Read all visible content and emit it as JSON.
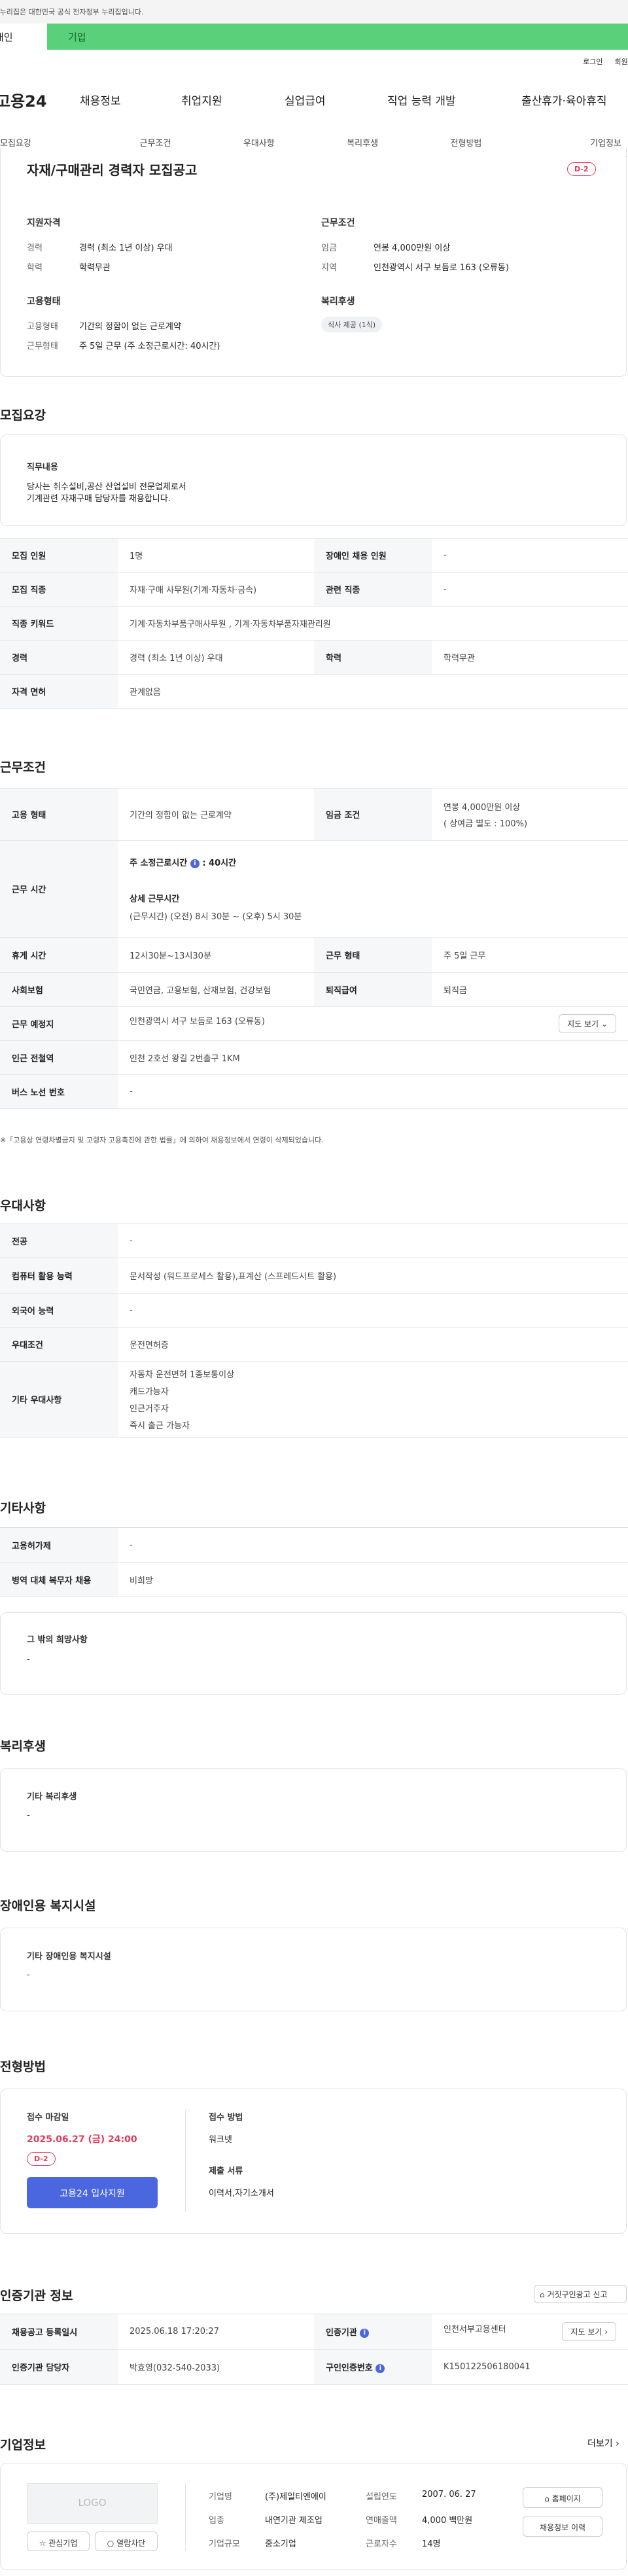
{
  "notice": "이 누리집은 대한민국 공식 전자정부 누리집입니다.",
  "context_tabs": {
    "left": "개인",
    "right": "기업"
  },
  "util": {
    "login": "로그인",
    "join": "회원가입"
  },
  "gnb": {
    "logo": "고용24",
    "menu": [
      "채용정보",
      "취업지원",
      "실업급여",
      "직업 능력 개발",
      "출산휴가·육아휴직"
    ]
  },
  "subtabs": [
    "모집요강",
    "근무조건",
    "우대사항",
    "복리후생",
    "전형방법",
    "기업정보"
  ],
  "summary": {
    "title": "자재/구매관리 경력자 모집공고",
    "dday": "D-2",
    "support": {
      "heading": "지원자격",
      "career_k": "경력",
      "career_v": "경력 (최소 1년 이상) 우대",
      "edu_k": "학력",
      "edu_v": "학력무관"
    },
    "condition": {
      "heading": "근무조건",
      "wage_k": "임금",
      "wage_v": "연봉 4,000만원 이상",
      "region_k": "지역",
      "region_v": "인천광역시 서구 보듬로 163 (오류동)"
    },
    "employment": {
      "heading": "고용형태",
      "type_k": "고용형태",
      "type_v": "기간의 정함이 없는 근로계약",
      "hours_k": "근무형태",
      "hours_v": "주 5일 근무 (주 소정근로시간: 40시간)"
    },
    "welfare": {
      "heading": "복리후생",
      "chip": "식사 제공 (1식)"
    }
  },
  "recruit": {
    "heading": "모집요강",
    "job_title": "직무내용",
    "job_desc1": "당사는 취수설비,공산 산업설비 전문업체로서",
    "job_desc2": "기계관련 자재구매 담당자를 채용합니다.",
    "rows": {
      "r1_k": "모집 인원",
      "r1_v": "1명",
      "r1_k2": "장애인 채용 인원",
      "r1_v2": "-",
      "r2_k": "모집 직종",
      "r2_v": "자재·구매 사무원(기계·자동차·금속)",
      "r2_k2": "관련 직종",
      "r2_v2": "-",
      "r3_k": "직종 키워드",
      "r3_v": "기계·자동차부품구매사무원 , 기계·자동차부품자재관리원",
      "r4_k": "경력",
      "r4_v": "경력 (최소 1년 이상) 우대",
      "r4_k2": "학력",
      "r4_v2": "학력무관",
      "r5_k": "자격 면허",
      "r5_v": "관계없음"
    }
  },
  "work": {
    "heading": "근무조건",
    "type_k": "고용 형태",
    "type_v": "기간의 정함이 없는 근로계약",
    "wage_k": "임금 조건",
    "wage_v1": "연봉 4,000만원 이상",
    "wage_v2": "( 상여금 별도 : 100%)",
    "hours_k": "근무 시간",
    "hours_v1": "주 소정근로시간",
    "hours_v1b": ": 40시간",
    "hours_v2": "상세 근무시간",
    "hours_v3": "(근무시간) (오전) 8시 30분 ~ (오후) 5시 30분",
    "rest_k": "휴게 시간",
    "rest_v": "12시30분~13시30분",
    "form_k": "근무 형태",
    "form_v": "주 5일 근무",
    "ins_k": "사회보험",
    "ins_v": "국민연금, 고용보험, 산재보험, 건강보험",
    "ret_k": "퇴직급여",
    "ret_v": "퇴직금",
    "place_k": "근무 예정지",
    "place_v": "인천광역시 서구 보듬로 163 (오류동)",
    "map_btn": "지도 보기",
    "sub_k": "인근 전철역",
    "sub_v": "인천 2호선 왕길 2번출구 1KM",
    "bus_k": "버스 노선 번호",
    "bus_v": "-",
    "note": "※「고용상 연령차별금지 및 고령자 고용촉진에 관한 법률」에 의하여 채용정보에서 연령이 삭제되었습니다."
  },
  "pref": {
    "heading": "우대사항",
    "major_k": "전공",
    "major_v": "-",
    "pc_k": "컴퓨터 활용 능력",
    "pc_v": "문서작성 (워드프로세스 활용),표계산 (스프레드시트 활용)",
    "lang_k": "외국어 능력",
    "lang_v": "-",
    "cond_k": "우대조건",
    "cond_v": "운전면허증",
    "etc_k": "기타 우대사항",
    "etc_v": [
      "자동차 운전면허 1종보통이상",
      "캐드가능자",
      "인근거주자",
      "즉시 출근 가능자"
    ]
  },
  "other": {
    "heading": "기타사항",
    "ins_k": "고용허가제",
    "ins_v": "-",
    "mil_k": "병역 대체 복무자 채용",
    "mil_v": "비희망",
    "hope_title": "그 밖의 희망사항",
    "hope_v": "-"
  },
  "welfare": {
    "heading": "복리후생",
    "title": "기타 복리후생",
    "v": "-"
  },
  "disabled": {
    "heading": "장애인용 복지시설",
    "title": "기타 장애인용 복지시설",
    "v": "-"
  },
  "screening": {
    "heading": "전형방법",
    "deadline_k": "접수 마감일",
    "deadline_v": "2025.06.27 (금) 24:00",
    "dday": "D-2",
    "apply_btn": "고용24 입사지원",
    "method_k": "접수 방법",
    "method_v": "워크넷",
    "docs_k": "제출 서류",
    "docs_v": "이력서,자기소개서"
  },
  "cert": {
    "heading": "인증기관 정보",
    "report_btn": "거짓구인광고 신고",
    "reg_k": "채용공고 등록일시",
    "reg_v": "2025.06.18 17:20:27",
    "org_k": "인증기관",
    "org_v": "인천서부고용센터",
    "map_btn": "지도 보기",
    "mgr_k": "인증기관 담당자",
    "mgr_v": "박효영(032-540-2033)",
    "no_k": "구인인증번호",
    "no_v": "K150122506180041"
  },
  "company": {
    "heading": "기업정보",
    "more": "더보기",
    "logo": "LOGO",
    "fav_btn": "관심기업",
    "block_btn": "열람차단",
    "name_k": "기업명",
    "name_v": "(주)제일티엔에이",
    "ind_k": "업종",
    "ind_v": "내연기관 제조업",
    "size_k": "기업규모",
    "size_v": "중소기업",
    "est_k": "설립연도",
    "est_v": "2007. 06. 27",
    "sales_k": "연매출액",
    "sales_v": "4,000 백만원",
    "emp_k": "근로자수",
    "emp_v": "14명",
    "home_btn": "홈페이지",
    "hist_btn": "채용정보 이력"
  },
  "colors": {
    "accent": "#4a67e0",
    "dday": "#e23a5c",
    "green": "#5ad07a"
  }
}
